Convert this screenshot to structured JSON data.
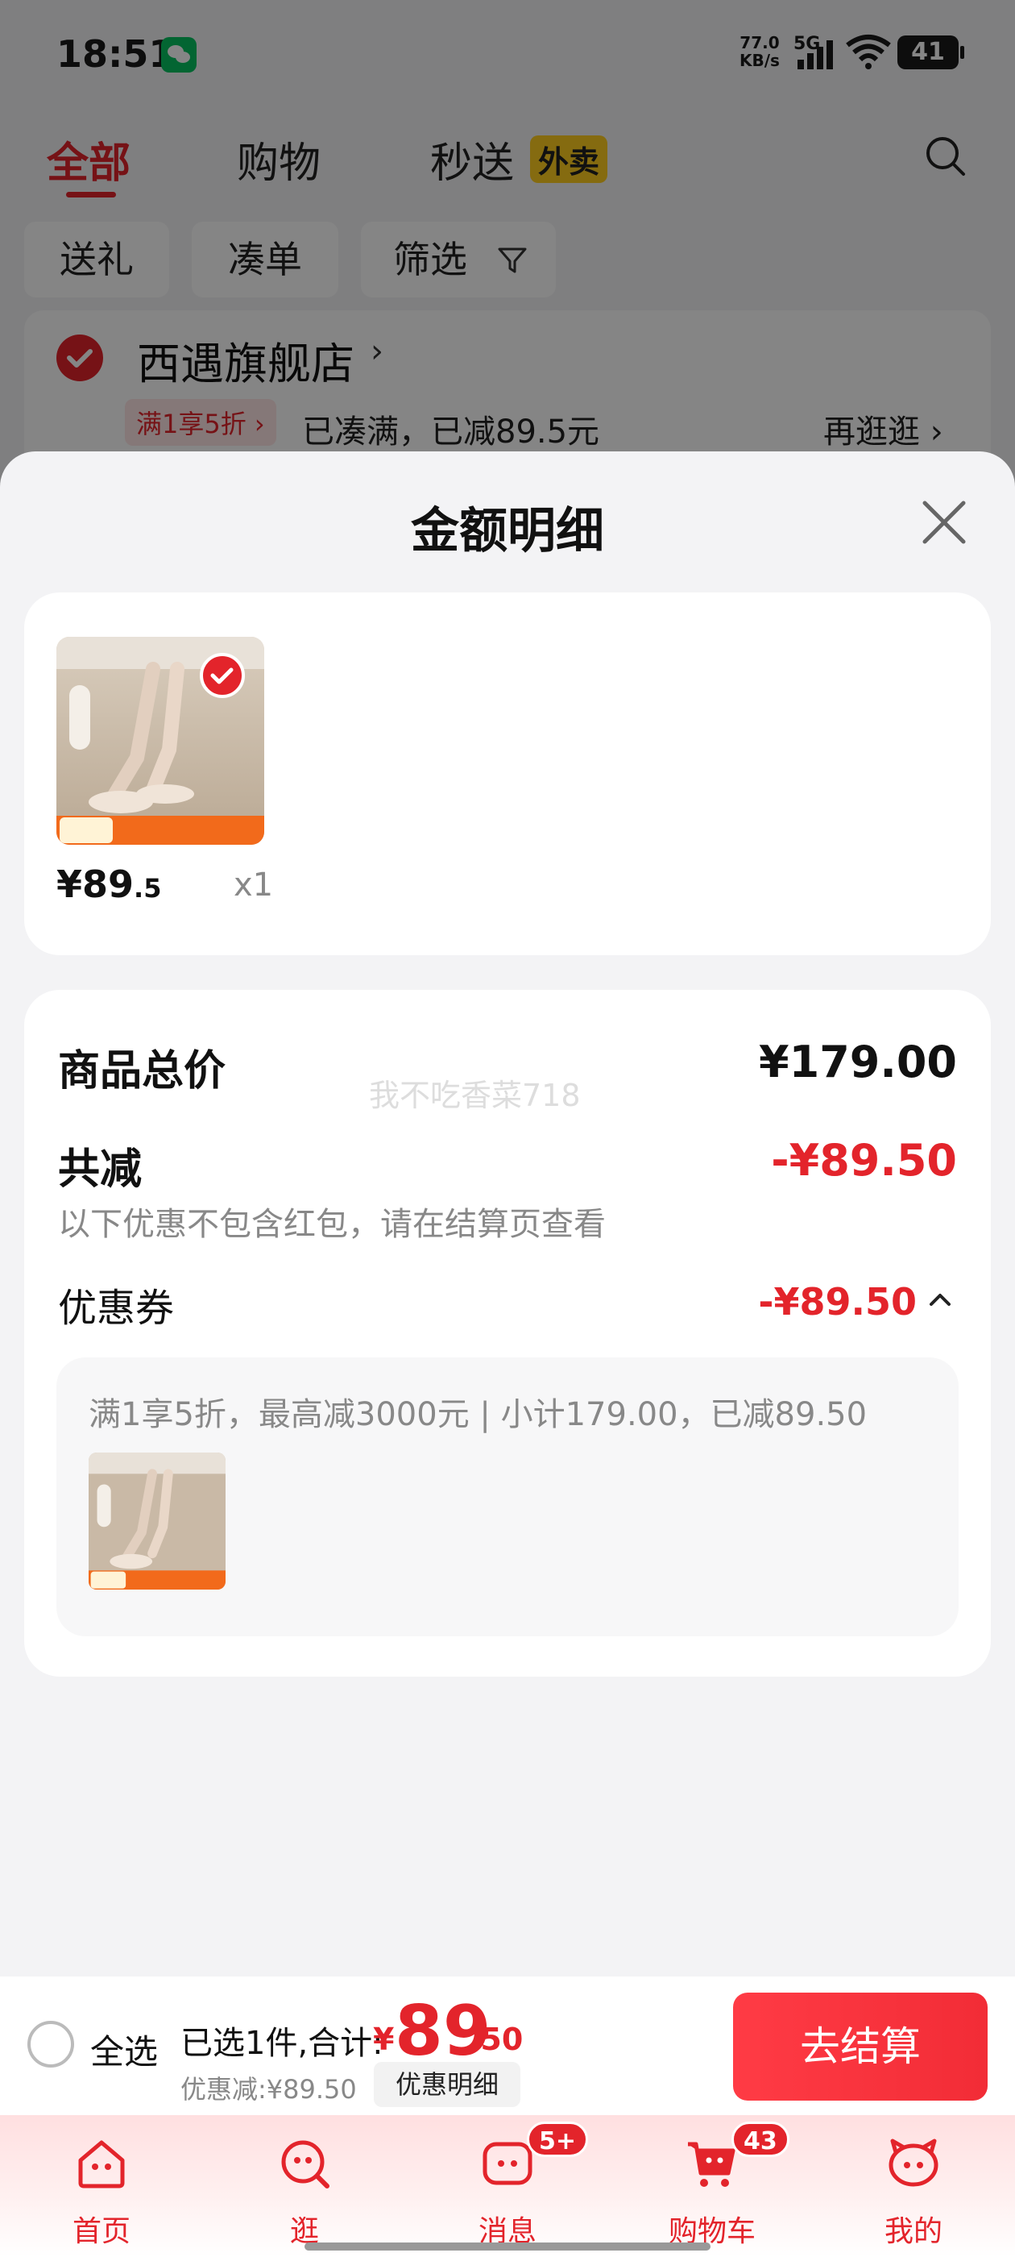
{
  "status_bar": {
    "time": "18:51",
    "net_speed_value": "77.0",
    "net_speed_unit": "KB/s",
    "network": "5G",
    "battery": "41"
  },
  "tabs": [
    {
      "label": "全部",
      "active": true
    },
    {
      "label": "购物",
      "active": false
    },
    {
      "label": "秒送",
      "active": false
    }
  ],
  "waimai_badge": "外卖",
  "filters": [
    "送礼",
    "凑单",
    "筛选"
  ],
  "store": {
    "name": "西遇旗舰店",
    "promo_tag": "满1享5折 ›",
    "promo_text": "已凑满，已减89.5元",
    "more_link": "再逛逛 ›"
  },
  "sheet": {
    "title": "金额明细",
    "item": {
      "price_main": "¥89",
      "price_decimal": ".5",
      "quantity": "x1"
    },
    "total_label": "商品总价",
    "total_value": "¥179.00",
    "reduction_label": "共减",
    "reduction_value": "-¥89.50",
    "reduction_note": "以下优惠不包含红包，请在结算页查看",
    "coupon_label": "优惠券",
    "coupon_value": "-¥89.50",
    "coupon_desc": "满1享5折，最高减3000元 | 小计179.00，已减89.50",
    "watermark": "我不吃香菜718"
  },
  "checkout": {
    "select_all": "全选",
    "selected_text": "已选1件,合计:",
    "total_yen": "¥",
    "total_main": "89",
    "total_decimal": ".50",
    "discount_text": "优惠减:¥89.50",
    "detail_button": "优惠明细",
    "checkout_button": "去结算"
  },
  "bottom_nav": [
    {
      "label": "首页",
      "icon": "home-icon",
      "badge": ""
    },
    {
      "label": "逛",
      "icon": "browse-icon",
      "badge": ""
    },
    {
      "label": "消息",
      "icon": "message-icon",
      "badge": "5+"
    },
    {
      "label": "购物车",
      "icon": "cart-icon",
      "badge": "43"
    },
    {
      "label": "我的",
      "icon": "profile-icon",
      "badge": ""
    }
  ],
  "colors": {
    "accent": "#e3242b",
    "badge_yellow": "#ffce1f"
  }
}
